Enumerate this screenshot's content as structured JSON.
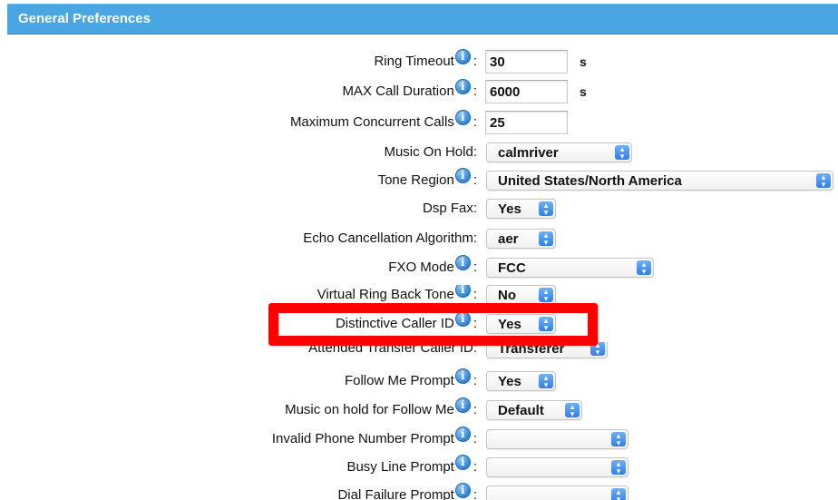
{
  "header": {
    "title": "General Preferences"
  },
  "units": {
    "seconds": "s"
  },
  "colon": ":",
  "info_glyph": "i",
  "fields": {
    "ring_timeout": {
      "label": "Ring Timeout",
      "value": "30"
    },
    "max_call_duration": {
      "label": "MAX Call Duration",
      "value": "6000"
    },
    "max_concurrent_calls": {
      "label": "Maximum Concurrent Calls",
      "value": "25"
    },
    "music_on_hold": {
      "label": "Music On Hold:",
      "value": "calmriver"
    },
    "tone_region": {
      "label": "Tone Region",
      "value": "United States/North America"
    },
    "dsp_fax": {
      "label": "Dsp Fax:",
      "value": "Yes"
    },
    "echo_cancellation": {
      "label": "Echo Cancellation Algorithm:",
      "value": "aer"
    },
    "fxo_mode": {
      "label": "FXO Mode",
      "value": "FCC"
    },
    "virtual_ring_back_tone": {
      "label": "Virtual Ring Back Tone",
      "value": "No"
    },
    "distinctive_caller_id": {
      "label": "Distinctive Caller ID",
      "value": "Yes"
    },
    "attended_transfer_caller_id": {
      "label": "Attended Transfer Caller ID:",
      "value": "Transferer"
    },
    "follow_me_prompt": {
      "label": "Follow Me Prompt",
      "value": "Yes"
    },
    "music_on_hold_follow_me": {
      "label": "Music on hold for Follow Me",
      "value": "Default"
    },
    "invalid_phone_number_prompt": {
      "label": "Invalid Phone Number Prompt",
      "value": ""
    },
    "busy_line_prompt": {
      "label": "Busy Line Prompt",
      "value": ""
    },
    "dial_failure_prompt": {
      "label": "Dial Failure Prompt",
      "value": ""
    }
  },
  "colors": {
    "header": "#4aa6e2",
    "highlight": "#ff0000",
    "select_arrow": "#2f7fe8"
  }
}
